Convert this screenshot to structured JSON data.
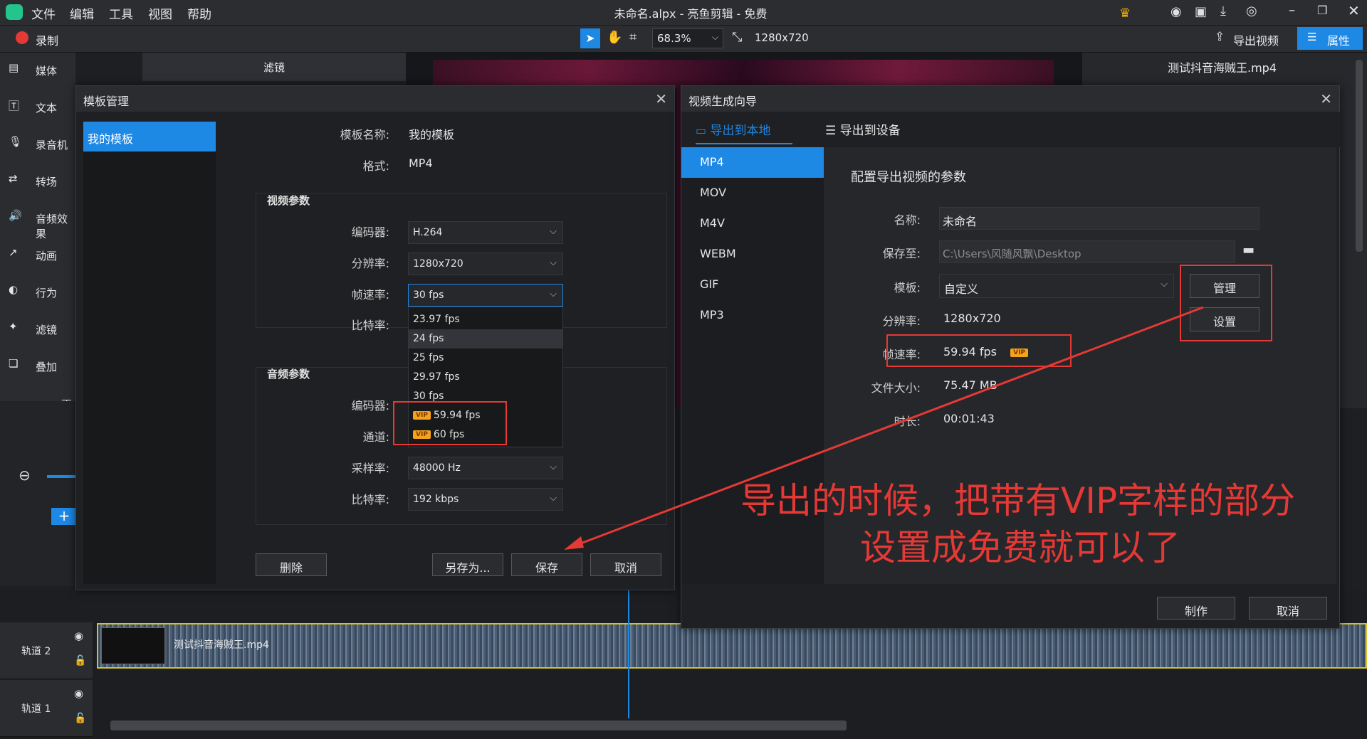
{
  "app": {
    "title": "未命名.alpx - 亮鱼剪辑 - 免费",
    "menu": [
      "文件",
      "编辑",
      "工具",
      "视图",
      "帮助"
    ]
  },
  "toolbar": {
    "record": "录制",
    "zoom": "68.3%",
    "resolution": "1280x720",
    "export": "导出视频",
    "properties": "属性"
  },
  "sidebar": {
    "items": [
      "媒体",
      "文本",
      "录音机",
      "转场",
      "音频效果",
      "动画",
      "行为",
      "滤镜",
      "叠加"
    ],
    "more": "更多"
  },
  "media": {
    "filter_tab": "滤镜"
  },
  "right": {
    "filename": "测试抖音海贼王.mp4"
  },
  "template_dialog": {
    "title": "模板管理",
    "list": [
      "我的模板"
    ],
    "name_label": "模板名称:",
    "name_value": "我的模板",
    "format_label": "格式:",
    "format_value": "MP4",
    "video_section": "视频参数",
    "encoder_label": "编码器:",
    "encoder_value": "H.264",
    "resolution_label": "分辨率:",
    "resolution_value": "1280x720",
    "fps_label": "帧速率:",
    "fps_value": "30 fps",
    "bitrate_label": "比特率:",
    "fps_options": [
      "23.97 fps",
      "24 fps",
      "25 fps",
      "29.97 fps",
      "30 fps",
      "59.94 fps",
      "60 fps"
    ],
    "vip_badge": "VIP",
    "audio_section": "音频参数",
    "a_encoder_label": "编码器:",
    "channel_label": "通道:",
    "samplerate_label": "采样率:",
    "samplerate_value": "48000 Hz",
    "a_bitrate_label": "比特率:",
    "a_bitrate_value": "192 kbps",
    "buttons": {
      "delete": "删除",
      "save_as": "另存为...",
      "save": "保存",
      "cancel": "取消"
    }
  },
  "export_dialog": {
    "title": "视频生成向导",
    "tabs": [
      "导出到本地",
      "导出到设备"
    ],
    "formats": [
      "MP4",
      "MOV",
      "M4V",
      "WEBM",
      "GIF",
      "MP3"
    ],
    "heading": "配置导出视频的参数",
    "name_label": "名称:",
    "name_value": "未命名",
    "save_label": "保存至:",
    "save_value": "C:\\Users\\风随风飘\\Desktop",
    "template_label": "模板:",
    "template_value": "自定义",
    "manage": "管理",
    "settings": "设置",
    "resolution_label": "分辨率:",
    "resolution_value": "1280x720",
    "fps_label": "帧速率:",
    "fps_value": "59.94 fps",
    "vip_badge": "VIP",
    "size_label": "文件大小:",
    "size_value": "75.47 MB",
    "duration_label": "时长:",
    "duration_value": "00:01:43",
    "buttons": {
      "make": "制作",
      "cancel": "取消"
    }
  },
  "annotation": {
    "line1": "导出的时候，把带有VIP字样的部分",
    "line2": "设置成免费就可以了"
  },
  "timeline": {
    "track2": "轨道 2",
    "track1": "轨道 1",
    "clip": "测试抖音海贼王.mp4"
  },
  "colors": {
    "accent": "#1e88e5",
    "annotation": "#e53935",
    "vip": "#f4a21a"
  }
}
